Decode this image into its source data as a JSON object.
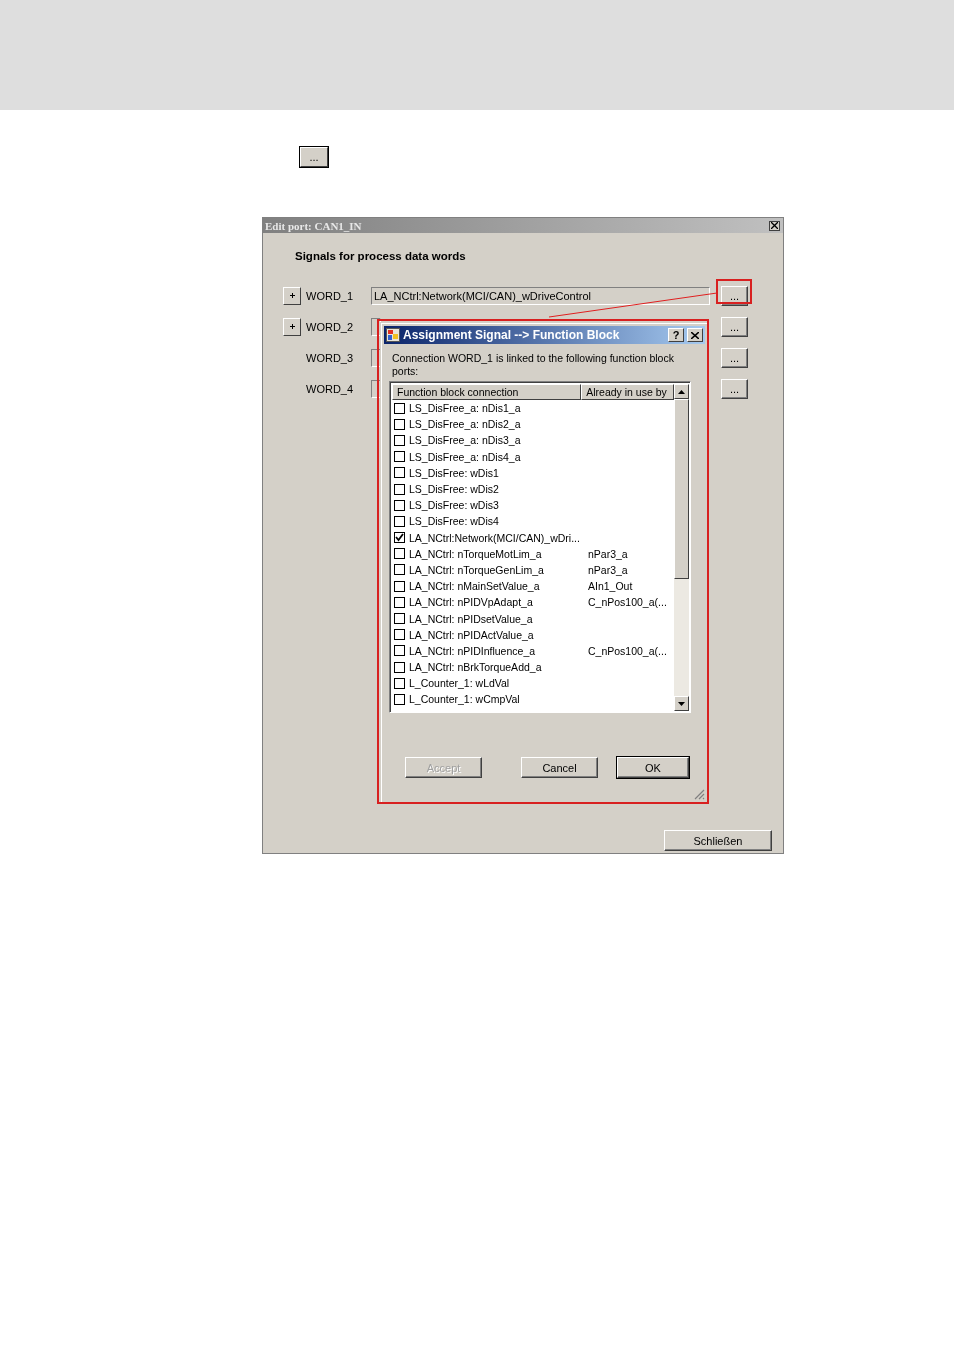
{
  "page_button": {
    "label": "..."
  },
  "window": {
    "title": "Edit port: CAN1_IN",
    "heading": "Signals for process data words",
    "words": [
      {
        "label": "WORD_1",
        "expandable": true,
        "value": "LA_NCtrl:Network(MCI/CAN)_wDriveControl",
        "button": "..."
      },
      {
        "label": "WORD_2",
        "expandable": true,
        "button": "..."
      },
      {
        "label": "WORD_3",
        "expandable": false,
        "button": "..."
      },
      {
        "label": "WORD_4",
        "expandable": false,
        "button": "..."
      }
    ],
    "close_button": "Schließen"
  },
  "dialog": {
    "title": "Assignment Signal --> Function Block",
    "help": "?",
    "message": "Connection WORD_1 is linked to the following function block ports:",
    "columns": [
      "Function block connection",
      "Already in use by"
    ],
    "rows": [
      {
        "name": "LS_DisFree_a: nDis1_a",
        "checked": false
      },
      {
        "name": "LS_DisFree_a: nDis2_a",
        "checked": false
      },
      {
        "name": "LS_DisFree_a: nDis3_a",
        "checked": false
      },
      {
        "name": "LS_DisFree_a: nDis4_a",
        "checked": false
      },
      {
        "name": "LS_DisFree: wDis1",
        "checked": false
      },
      {
        "name": "LS_DisFree: wDis2",
        "checked": false
      },
      {
        "name": "LS_DisFree: wDis3",
        "checked": false
      },
      {
        "name": "LS_DisFree: wDis4",
        "checked": false
      },
      {
        "name": "LA_NCtrl:Network(MCI/CAN)_wDri...",
        "checked": true
      },
      {
        "name": "LA_NCtrl: nTorqueMotLim_a",
        "used_by": "nPar3_a",
        "checked": false
      },
      {
        "name": "LA_NCtrl: nTorqueGenLim_a",
        "used_by": "nPar3_a",
        "checked": false
      },
      {
        "name": "LA_NCtrl: nMainSetValue_a",
        "used_by": "AIn1_Out",
        "checked": false
      },
      {
        "name": "LA_NCtrl: nPIDVpAdapt_a",
        "used_by": "C_nPos100_a(...",
        "checked": false
      },
      {
        "name": "LA_NCtrl: nPIDsetValue_a",
        "checked": false
      },
      {
        "name": "LA_NCtrl: nPIDActValue_a",
        "checked": false
      },
      {
        "name": "LA_NCtrl: nPIDInfluence_a",
        "used_by": "C_nPos100_a(...",
        "checked": false
      },
      {
        "name": "LA_NCtrl: nBrkTorqueAdd_a",
        "checked": false
      },
      {
        "name": "L_Counter_1: wLdVal",
        "checked": false
      },
      {
        "name": "L_Counter_1: wCmpVal",
        "checked": false
      }
    ],
    "buttons": [
      {
        "label": "Accept",
        "disabled": true,
        "default": false
      },
      {
        "label": "Cancel",
        "disabled": false,
        "default": false
      },
      {
        "label": "OK",
        "disabled": false,
        "default": true
      }
    ]
  }
}
